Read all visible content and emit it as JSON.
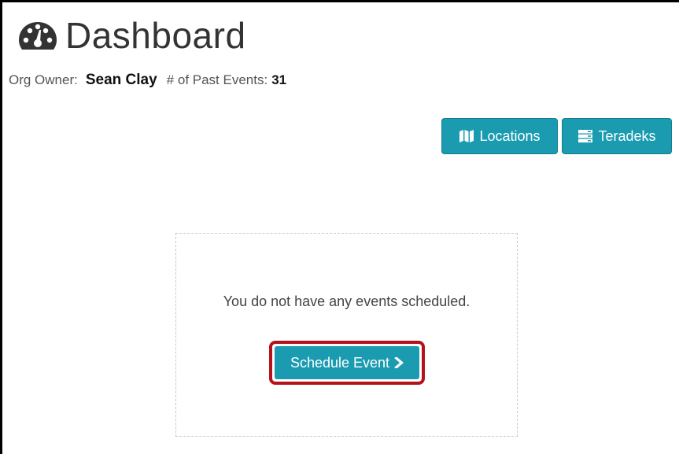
{
  "header": {
    "title": "Dashboard",
    "icon": "dashboard-gauge-icon"
  },
  "meta": {
    "owner_label": "Org Owner:",
    "owner_name": "Sean Clay",
    "past_events_label": "# of Past Events:",
    "past_events_count": "31"
  },
  "actions": {
    "locations_label": "Locations",
    "locations_icon": "map-icon",
    "teradeks_label": "Teradeks",
    "teradeks_icon": "server-icon"
  },
  "empty_state": {
    "message": "You do not have any events scheduled.",
    "schedule_label": "Schedule Event",
    "schedule_icon": "chevron-right-icon"
  },
  "colors": {
    "accent": "#1a9bb0",
    "highlight": "#b5121b"
  }
}
